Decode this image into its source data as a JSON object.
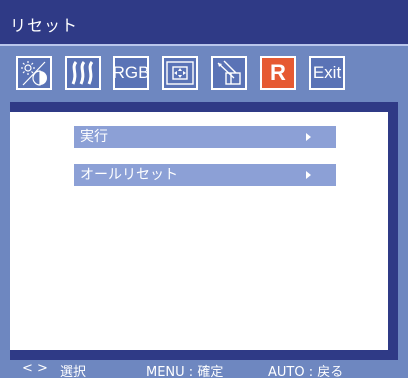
{
  "window": {
    "title": "リセット"
  },
  "toolbar": {
    "icons": [
      {
        "name": "brightness-contrast-icon",
        "selected": false
      },
      {
        "name": "sharpness-icon",
        "selected": false
      },
      {
        "name": "rgb-icon",
        "label": "RGB",
        "selected": false
      },
      {
        "name": "position-icon",
        "selected": false
      },
      {
        "name": "setup-icon",
        "selected": false
      },
      {
        "name": "reset-icon",
        "label": "R",
        "selected": true
      },
      {
        "name": "exit-icon",
        "label": "Exit",
        "selected": false
      }
    ]
  },
  "menu": {
    "items": [
      {
        "label": "実行"
      },
      {
        "label": "オールリセット"
      }
    ]
  },
  "footer": {
    "nav_arrows": "< >",
    "select_label": "選択",
    "menu_label": "MENU : 確定",
    "auto_label": "AUTO : 戻る"
  },
  "colors": {
    "panel": "#6e87c0",
    "title_bar": "#2f3a86",
    "selected": "#e65a32",
    "menu_item": "#8ca0d6"
  }
}
